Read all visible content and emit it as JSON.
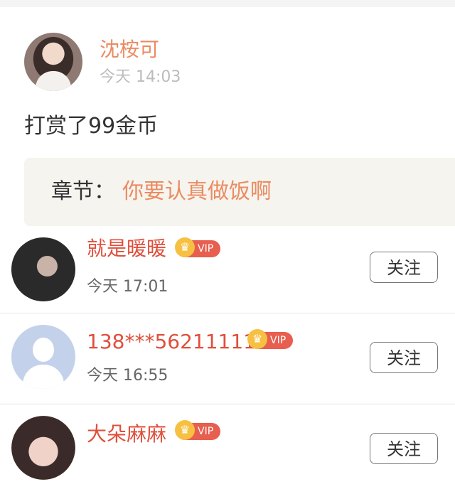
{
  "post": {
    "author_name": "沈桉可",
    "time": "今天 14:03",
    "content": "打赏了99金币",
    "chapter_label": "章节：",
    "chapter_title": "你要认真做饭啊"
  },
  "comments": [
    {
      "name": "就是暖暖",
      "badge": "VIP",
      "time": "今天 17:01",
      "follow_label": "关注"
    },
    {
      "name": "138***56211111",
      "badge": "VIP",
      "time": "今天 16:55",
      "follow_label": "关注"
    },
    {
      "name": "大朵麻麻",
      "badge": "VIP",
      "time": "",
      "follow_label": "关注"
    }
  ],
  "icons": {
    "crown": "crown-icon"
  },
  "colors": {
    "accent_orange": "#eb8b61",
    "name_red": "#e04f3c",
    "vip_red": "#e85e4f",
    "crown_gold": "#f6c142"
  }
}
